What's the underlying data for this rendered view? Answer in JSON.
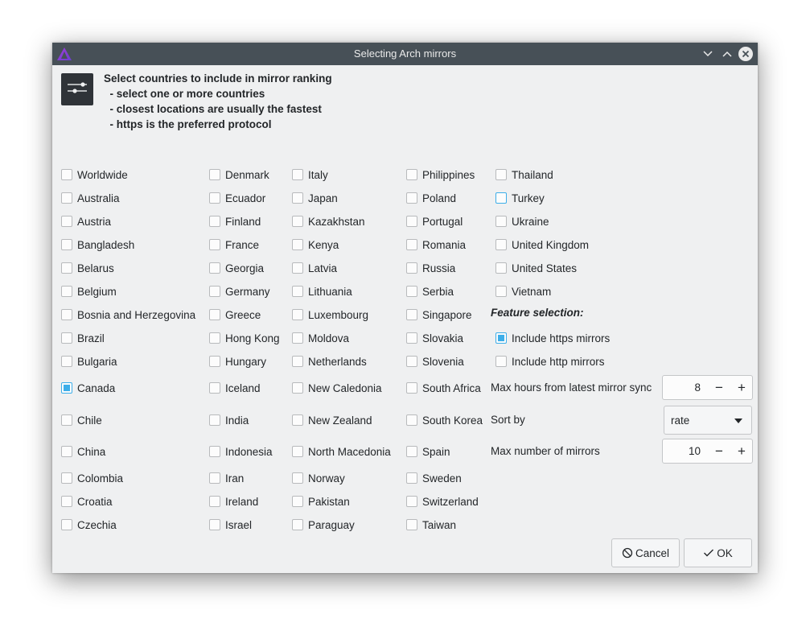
{
  "window": {
    "title": "Selecting Arch mirrors"
  },
  "header": {
    "text": "Select countries to include in mirror ranking\n  - select one or more countries\n  - closest locations are usually the fastest\n  - https is the preferred protocol"
  },
  "countries": {
    "col1": [
      "Worldwide",
      "Australia",
      "Austria",
      "Bangladesh",
      "Belarus",
      "Belgium",
      "Bosnia and Herzegovina",
      "Brazil",
      "Bulgaria",
      "Canada",
      "Chile",
      "China",
      "Colombia",
      "Croatia",
      "Czechia"
    ],
    "col2": [
      "Denmark",
      "Ecuador",
      "Finland",
      "France",
      "Georgia",
      "Germany",
      "Greece",
      "Hong Kong",
      "Hungary",
      "Iceland",
      "India",
      "Indonesia",
      "Iran",
      "Ireland",
      "Israel"
    ],
    "col3": [
      "Italy",
      "Japan",
      "Kazakhstan",
      "Kenya",
      "Latvia",
      "Lithuania",
      "Luxembourg",
      "Moldova",
      "Netherlands",
      "New Caledonia",
      "New Zealand",
      "North Macedonia",
      "Norway",
      "Pakistan",
      "Paraguay"
    ],
    "col4": [
      "Philippines",
      "Poland",
      "Portugal",
      "Romania",
      "Russia",
      "Serbia",
      "Singapore",
      "Slovakia",
      "Slovenia",
      "South Africa",
      "South Korea",
      "Spain",
      "Sweden",
      "Switzerland",
      "Taiwan"
    ],
    "col5": [
      "Thailand",
      "Turkey",
      "Ukraine",
      "United Kingdom",
      "United States",
      "Vietnam"
    ],
    "checked": [
      "Canada"
    ],
    "hovered": [
      "Turkey"
    ]
  },
  "features": {
    "heading": "Feature selection:",
    "https_label": "Include https mirrors",
    "https_checked": true,
    "http_label": "Include http mirrors",
    "http_checked": false
  },
  "max_hours": {
    "label": "Max hours from latest mirror sync",
    "value": "8"
  },
  "sort_by": {
    "label": "Sort by",
    "value": "rate"
  },
  "max_mirrors": {
    "label": "Max number of mirrors",
    "value": "10"
  },
  "buttons": {
    "cancel": "Cancel",
    "ok": "OK"
  },
  "colors": {
    "accent": "#3daee9",
    "titlebar": "#475057",
    "background": "#eff0f1"
  }
}
